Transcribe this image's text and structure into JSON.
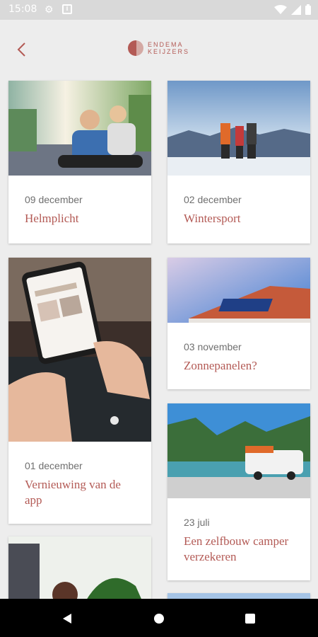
{
  "status_bar": {
    "time": "15:08",
    "icons": [
      "gear-icon",
      "info-icon",
      "wifi-icon",
      "signal-icon",
      "battery-icon"
    ]
  },
  "app_bar": {
    "logo_line1": "ENDEMA",
    "logo_line2": "KEIJZERS",
    "brand_color": "#b35a55"
  },
  "articles": [
    {
      "date": "09 december",
      "title": "Helmplicht"
    },
    {
      "date": "02 december",
      "title": "Wintersport"
    },
    {
      "date": "01 december",
      "title": "Vernieuwing van de app"
    },
    {
      "date": "03 november",
      "title": "Zonnepanelen?"
    },
    {
      "date": "23 juli",
      "title": "Een zelfbouw camper verzekeren"
    }
  ]
}
